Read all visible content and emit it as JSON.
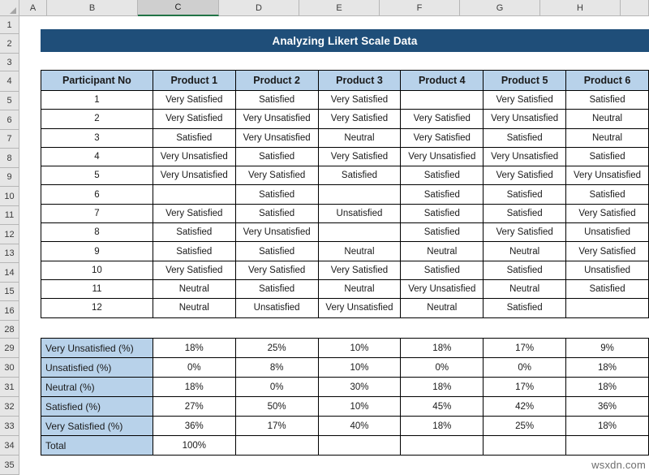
{
  "app": {
    "type": "spreadsheet",
    "watermark": "wsxdn.com"
  },
  "grid": {
    "column_headers": [
      "A",
      "B",
      "C",
      "D",
      "E",
      "F",
      "G",
      "H"
    ],
    "selected_column": "C",
    "row_headers": [
      "1",
      "2",
      "3",
      "4",
      "5",
      "6",
      "7",
      "8",
      "9",
      "10",
      "11",
      "12",
      "13",
      "14",
      "15",
      "16",
      "28",
      "29",
      "30",
      "31",
      "32",
      "33",
      "34",
      "35"
    ]
  },
  "title_banner": {
    "text": "Analyzing Likert Scale Data",
    "background": "#1f4e79",
    "color": "#ffffff"
  },
  "colors": {
    "header_blue": "#b8d2ea",
    "banner_blue": "#1f4e79",
    "grid_line": "#d0d0d0",
    "border": "#000000",
    "selected_tab_green": "#217346"
  },
  "data_table": {
    "headers": [
      "Participant No",
      "Product 1",
      "Product 2",
      "Product 3",
      "Product 4",
      "Product 5",
      "Product 6"
    ],
    "rows": [
      [
        "1",
        "Very Satisfied",
        "Satisfied",
        "Very Satisfied",
        "",
        "Very Satisfied",
        "Satisfied"
      ],
      [
        "2",
        "Very Satisfied",
        "Very Unsatisfied",
        "Very Satisfied",
        "Very Satisfied",
        "Very Unsatisfied",
        "Neutral"
      ],
      [
        "3",
        "Satisfied",
        "Very Unsatisfied",
        "Neutral",
        "Very Satisfied",
        "Satisfied",
        "Neutral"
      ],
      [
        "4",
        "Very Unsatisfied",
        "Satisfied",
        "Very Satisfied",
        "Very Unsatisfied",
        "Very Unsatisfied",
        "Satisfied"
      ],
      [
        "5",
        "Very Unsatisfied",
        "Very Satisfied",
        "Satisfied",
        "Satisfied",
        "Very Satisfied",
        "Very Unsatisfied"
      ],
      [
        "6",
        "",
        "Satisfied",
        "",
        "Satisfied",
        "Satisfied",
        "Satisfied"
      ],
      [
        "7",
        "Very Satisfied",
        "Satisfied",
        "Unsatisfied",
        "Satisfied",
        "Satisfied",
        "Very Satisfied"
      ],
      [
        "8",
        "Satisfied",
        "Very Unsatisfied",
        "",
        "Satisfied",
        "Very Satisfied",
        "Unsatisfied"
      ],
      [
        "9",
        "Satisfied",
        "Satisfied",
        "Neutral",
        "Neutral",
        "Neutral",
        "Very Satisfied"
      ],
      [
        "10",
        "Very Satisfied",
        "Very Satisfied",
        "Very Satisfied",
        "Satisfied",
        "Satisfied",
        "Unsatisfied"
      ],
      [
        "11",
        "Neutral",
        "Satisfied",
        "Neutral",
        "Very Unsatisfied",
        "Neutral",
        "Satisfied"
      ],
      [
        "12",
        "Neutral",
        "Unsatisfied",
        "Very Unsatisfied",
        "Neutral",
        "Satisfied",
        ""
      ]
    ]
  },
  "summary_table": {
    "rows": [
      {
        "label": "Very Unsatisfied (%)",
        "values": [
          "18%",
          "25%",
          "10%",
          "18%",
          "17%",
          "9%"
        ]
      },
      {
        "label": "Unsatisfied (%)",
        "values": [
          "0%",
          "8%",
          "10%",
          "0%",
          "0%",
          "18%"
        ]
      },
      {
        "label": "Neutral (%)",
        "values": [
          "18%",
          "0%",
          "30%",
          "18%",
          "17%",
          "18%"
        ]
      },
      {
        "label": "Satisfied (%)",
        "values": [
          "27%",
          "50%",
          "10%",
          "45%",
          "42%",
          "36%"
        ]
      },
      {
        "label": "Very Satisfied (%)",
        "values": [
          "36%",
          "17%",
          "40%",
          "18%",
          "25%",
          "18%"
        ]
      },
      {
        "label": "Total",
        "values": [
          "100%",
          "",
          "",
          "",
          "",
          ""
        ]
      }
    ]
  }
}
